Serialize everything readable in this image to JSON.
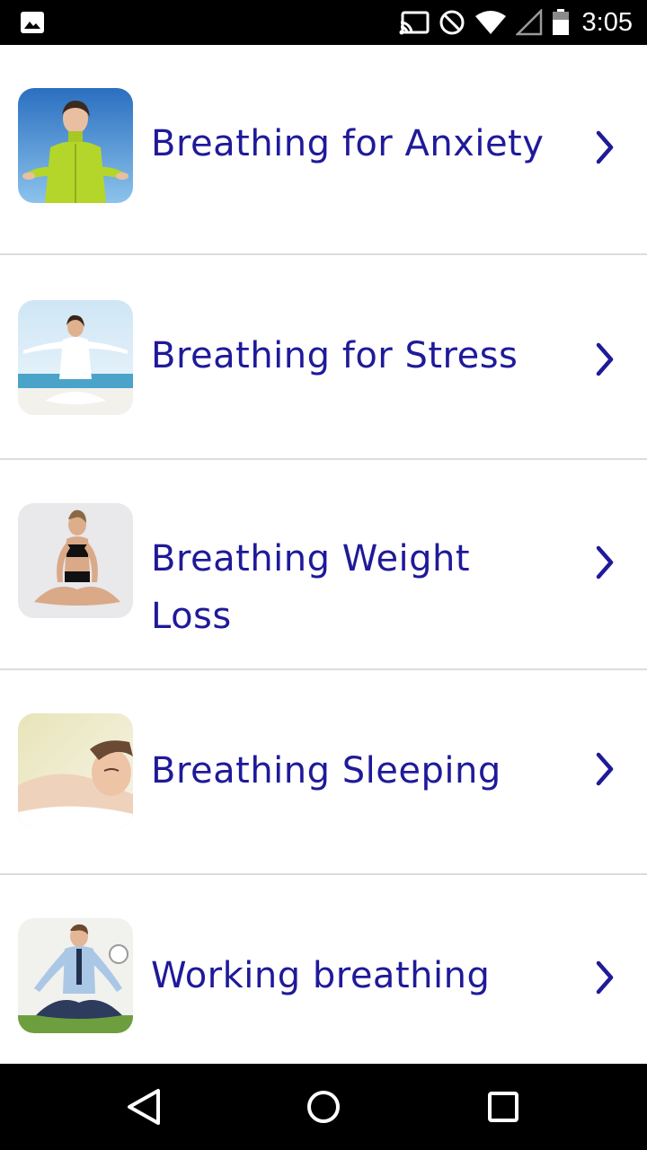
{
  "status_bar": {
    "time": "3:05",
    "icons": [
      "image-icon",
      "cast-icon",
      "do-not-disturb-icon",
      "wifi-icon",
      "signal-icon",
      "battery-icon"
    ]
  },
  "list": {
    "items": [
      {
        "label": "Breathing for Anxiety",
        "thumbnail": "woman-breathing-outdoors-photo",
        "chevron": "chevron-right-icon"
      },
      {
        "label": "Breathing for Stress",
        "thumbnail": "woman-meditating-beach-photo",
        "chevron": "chevron-right-icon"
      },
      {
        "label": "Breathing Weight Loss",
        "thumbnail": "woman-yoga-lotus-photo",
        "chevron": "chevron-right-icon"
      },
      {
        "label": "Breathing Sleeping",
        "thumbnail": "woman-sleeping-photo",
        "chevron": "chevron-right-icon"
      },
      {
        "label": "Working breathing",
        "thumbnail": "businessman-meditating-photo",
        "chevron": "chevron-right-icon"
      }
    ]
  },
  "nav_bar": {
    "buttons": [
      "back-icon",
      "home-icon",
      "recents-icon"
    ]
  },
  "colors": {
    "label": "#1f1a99",
    "divider": "#dcdcdc",
    "bars": "#000000"
  }
}
